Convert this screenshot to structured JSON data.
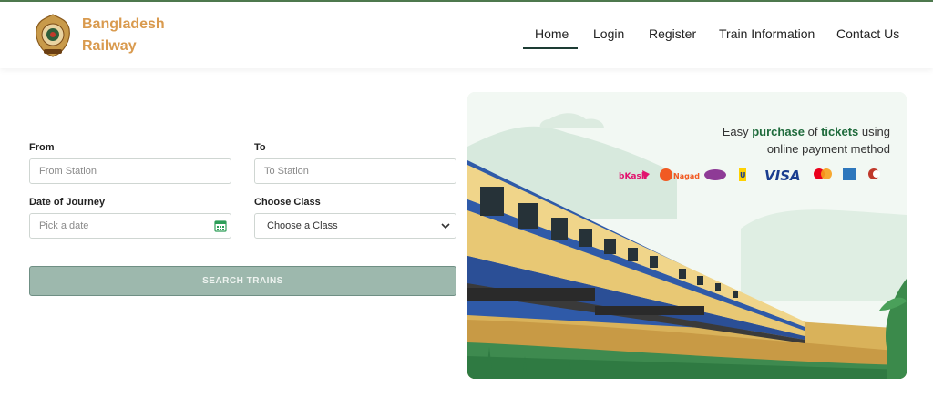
{
  "brand": {
    "line1": "Bangladesh",
    "line2": "Railway"
  },
  "nav": {
    "home": "Home",
    "login": "Login",
    "register": "Register",
    "train_info": "Train Information",
    "contact": "Contact Us"
  },
  "form": {
    "from_label": "From",
    "from_placeholder": "From Station",
    "to_label": "To",
    "to_placeholder": "To Station",
    "date_label": "Date of Journey",
    "date_placeholder": "Pick a date",
    "class_label": "Choose Class",
    "class_value": "Choose a Class",
    "search_label": "SEARCH TRAINS"
  },
  "hero": {
    "line1_a": "Easy ",
    "line1_b": "purchase",
    "line1_c": " of ",
    "line1_d": "tickets",
    "line1_e": " using",
    "line2": "online payment method"
  },
  "payments": [
    "bKash",
    "Nagad",
    "Rocket",
    "Upay",
    "VISA",
    "Mastercard",
    "Amex",
    "DBBL Nexus"
  ],
  "colors": {
    "brand": "#d99a4e",
    "accent_green": "#1f6b3c",
    "button": "#9db8ad",
    "nav_underline": "#1d3c34"
  }
}
